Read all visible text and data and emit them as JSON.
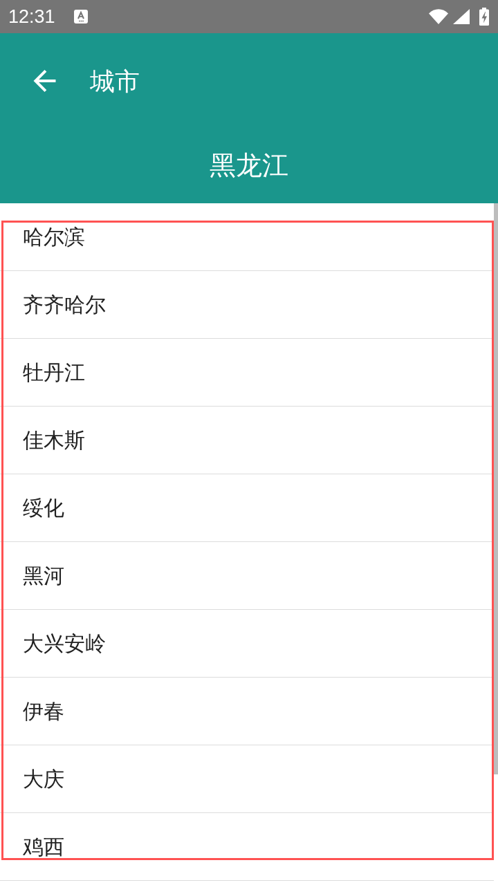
{
  "status_bar": {
    "time": "12:31"
  },
  "app_bar": {
    "title": "城市",
    "subtitle": "黑龙江"
  },
  "cities": [
    {
      "name": "哈尔滨"
    },
    {
      "name": "齐齐哈尔"
    },
    {
      "name": "牡丹江"
    },
    {
      "name": "佳木斯"
    },
    {
      "name": "绥化"
    },
    {
      "name": "黑河"
    },
    {
      "name": "大兴安岭"
    },
    {
      "name": "伊春"
    },
    {
      "name": "大庆"
    },
    {
      "name": "鸡西"
    }
  ]
}
